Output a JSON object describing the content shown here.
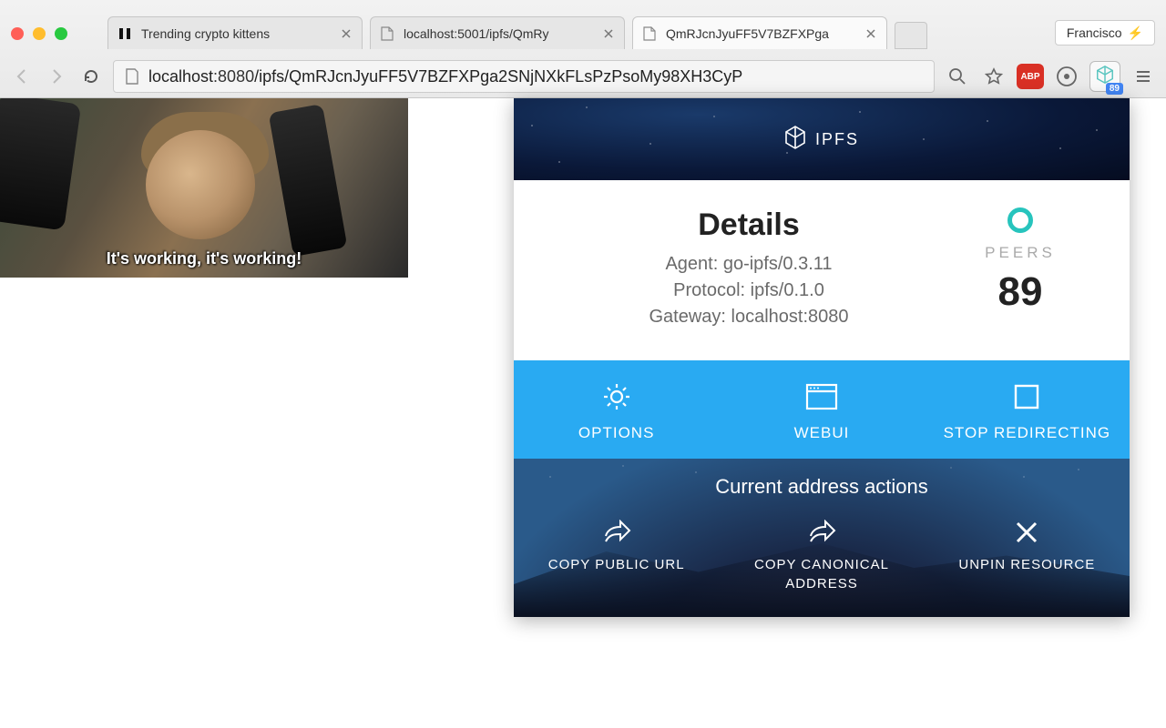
{
  "browser": {
    "user_name": "Francisco",
    "tabs": [
      {
        "title": "Trending crypto kittens",
        "active": false
      },
      {
        "title": "localhost:5001/ipfs/QmRy",
        "active": false
      },
      {
        "title": "QmRJcnJyuFF5V7BZFXPga",
        "active": true
      }
    ],
    "url_host": "localhost",
    "url_port": ":8080",
    "url_path": "/ipfs/QmRJcnJyuFF5V7BZFXPga2SNjNXkFLsPzPsoMy98XH3CyP",
    "ipfs_badge": "89",
    "abp_label": "ABP"
  },
  "page": {
    "gif_caption": "It's working, it's working!"
  },
  "popup": {
    "brand": "IPFS",
    "details_title": "Details",
    "agent_label": "Agent:",
    "agent_value": "go-ipfs/0.3.11",
    "protocol_label": "Protocol:",
    "protocol_value": "ipfs/0.1.0",
    "gateway_label": "Gateway:",
    "gateway_value": "localhost:8080",
    "peers_label": "PEERS",
    "peers_count": "89",
    "actions": {
      "options": "OPTIONS",
      "webui": "WEBUI",
      "stop_redirect": "STOP REDIRECTING"
    },
    "addr_title": "Current address actions",
    "addr_actions": {
      "copy_public": "COPY PUBLIC URL",
      "copy_canonical": "COPY CANONICAL ADDRESS",
      "unpin": "UNPIN RESOURCE"
    }
  }
}
